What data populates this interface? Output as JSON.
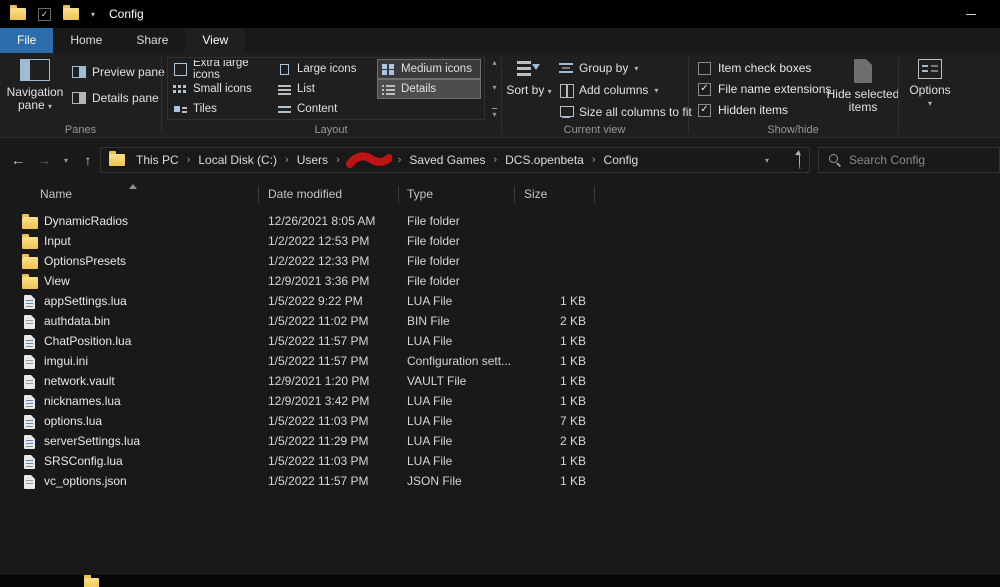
{
  "icons": {
    "back": "←",
    "forward": "→",
    "up": "↑",
    "dropdown": "▾",
    "crumb_sep": "›",
    "check": "✓",
    "gallery_up": "▴",
    "gallery_down": "▾"
  },
  "titlebar": {
    "title": "Config"
  },
  "tabs": {
    "file": "File",
    "home": "Home",
    "share": "Share",
    "view": "View"
  },
  "ribbon": {
    "panes": {
      "group_label": "Panes",
      "navigation_pane": "Navigation pane",
      "preview_pane": "Preview pane",
      "details_pane": "Details pane"
    },
    "layout": {
      "group_label": "Layout",
      "items": [
        {
          "label": "Extra large icons"
        },
        {
          "label": "Large icons"
        },
        {
          "label": "Medium icons",
          "highlighted": true
        },
        {
          "label": "Small icons"
        },
        {
          "label": "List"
        },
        {
          "label": "Details",
          "selected": true
        },
        {
          "label": "Tiles"
        },
        {
          "label": "Content"
        }
      ]
    },
    "current_view": {
      "group_label": "Current view",
      "sort_by": "Sort by",
      "group_by": "Group by",
      "add_columns": "Add columns",
      "size_all_columns": "Size all columns to fit"
    },
    "show_hide": {
      "group_label": "Show/hide",
      "checkboxes": [
        {
          "label": "Item check boxes",
          "checked": false
        },
        {
          "label": "File name extensions",
          "checked": true
        },
        {
          "label": "Hidden items",
          "checked": true
        }
      ],
      "hide_selected_items": "Hide selected items"
    },
    "options": {
      "label": "Options"
    }
  },
  "address_bar": {
    "breadcrumbs": [
      {
        "label": "This PC"
      },
      {
        "label": "Local Disk (C:)"
      },
      {
        "label": "Users"
      },
      {
        "label": "",
        "redacted": true
      },
      {
        "label": "Saved Games"
      },
      {
        "label": "DCS.openbeta"
      },
      {
        "label": "Config"
      }
    ],
    "search_placeholder": "Search Config"
  },
  "file_list": {
    "columns": [
      {
        "label": "Name",
        "sort": "asc"
      },
      {
        "label": "Date modified"
      },
      {
        "label": "Type"
      },
      {
        "label": "Size"
      }
    ],
    "rows": [
      {
        "name": "DynamicRadios",
        "date": "12/26/2021 8:05 AM",
        "type": "File folder",
        "size": "",
        "icon": "folder"
      },
      {
        "name": "Input",
        "date": "1/2/2022 12:53 PM",
        "type": "File folder",
        "size": "",
        "icon": "folder"
      },
      {
        "name": "OptionsPresets",
        "date": "1/2/2022 12:33 PM",
        "type": "File folder",
        "size": "",
        "icon": "folder"
      },
      {
        "name": "View",
        "date": "12/9/2021 3:36 PM",
        "type": "File folder",
        "size": "",
        "icon": "folder"
      },
      {
        "name": "appSettings.lua",
        "date": "1/5/2022 9:22 PM",
        "type": "LUA File",
        "size": "1 KB",
        "icon": "lua-file"
      },
      {
        "name": "authdata.bin",
        "date": "1/5/2022 11:02 PM",
        "type": "BIN File",
        "size": "2 KB",
        "icon": "file"
      },
      {
        "name": "ChatPosition.lua",
        "date": "1/5/2022 11:57 PM",
        "type": "LUA File",
        "size": "1 KB",
        "icon": "lua-file"
      },
      {
        "name": "imgui.ini",
        "date": "1/5/2022 11:57 PM",
        "type": "Configuration sett...",
        "size": "1 KB",
        "icon": "file"
      },
      {
        "name": "network.vault",
        "date": "12/9/2021 1:20 PM",
        "type": "VAULT File",
        "size": "1 KB",
        "icon": "file"
      },
      {
        "name": "nicknames.lua",
        "date": "12/9/2021 3:42 PM",
        "type": "LUA File",
        "size": "1 KB",
        "icon": "lua-file"
      },
      {
        "name": "options.lua",
        "date": "1/5/2022 11:03 PM",
        "type": "LUA File",
        "size": "7 KB",
        "icon": "lua-file"
      },
      {
        "name": "serverSettings.lua",
        "date": "1/5/2022 11:29 PM",
        "type": "LUA File",
        "size": "2 KB",
        "icon": "lua-file"
      },
      {
        "name": "SRSConfig.lua",
        "date": "1/5/2022 11:03 PM",
        "type": "LUA File",
        "size": "1 KB",
        "icon": "lua-file"
      },
      {
        "name": "vc_options.json",
        "date": "1/5/2022 11:57 PM",
        "type": "JSON File",
        "size": "1 KB",
        "icon": "file"
      }
    ]
  }
}
